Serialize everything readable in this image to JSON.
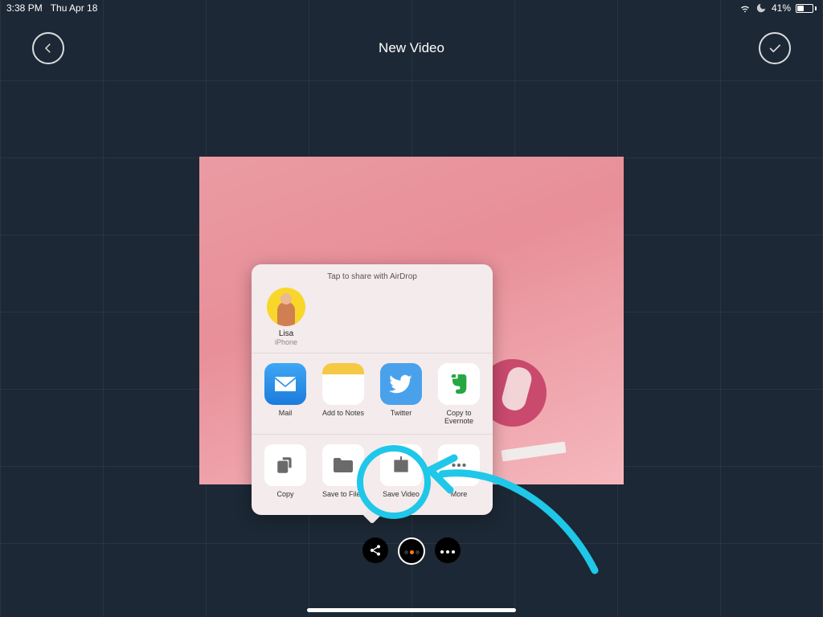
{
  "status": {
    "time": "3:38 PM",
    "date": "Thu Apr 18",
    "battery_pct": "41%"
  },
  "header": {
    "title": "New Video"
  },
  "share": {
    "airdrop_prompt": "Tap to share with AirDrop",
    "contacts": [
      {
        "name": "Lisa",
        "device": "iPhone"
      }
    ],
    "apps": [
      {
        "label": "Mail",
        "icon": "mail"
      },
      {
        "label": "Add to Notes",
        "icon": "notes"
      },
      {
        "label": "Twitter",
        "icon": "twitter"
      },
      {
        "label": "Copy to Evernote",
        "icon": "evernote"
      }
    ],
    "actions": [
      {
        "label": "Copy",
        "icon": "copy"
      },
      {
        "label": "Save to Files",
        "icon": "folder"
      },
      {
        "label": "Save Video",
        "icon": "save-video"
      },
      {
        "label": "More",
        "icon": "more"
      }
    ]
  }
}
